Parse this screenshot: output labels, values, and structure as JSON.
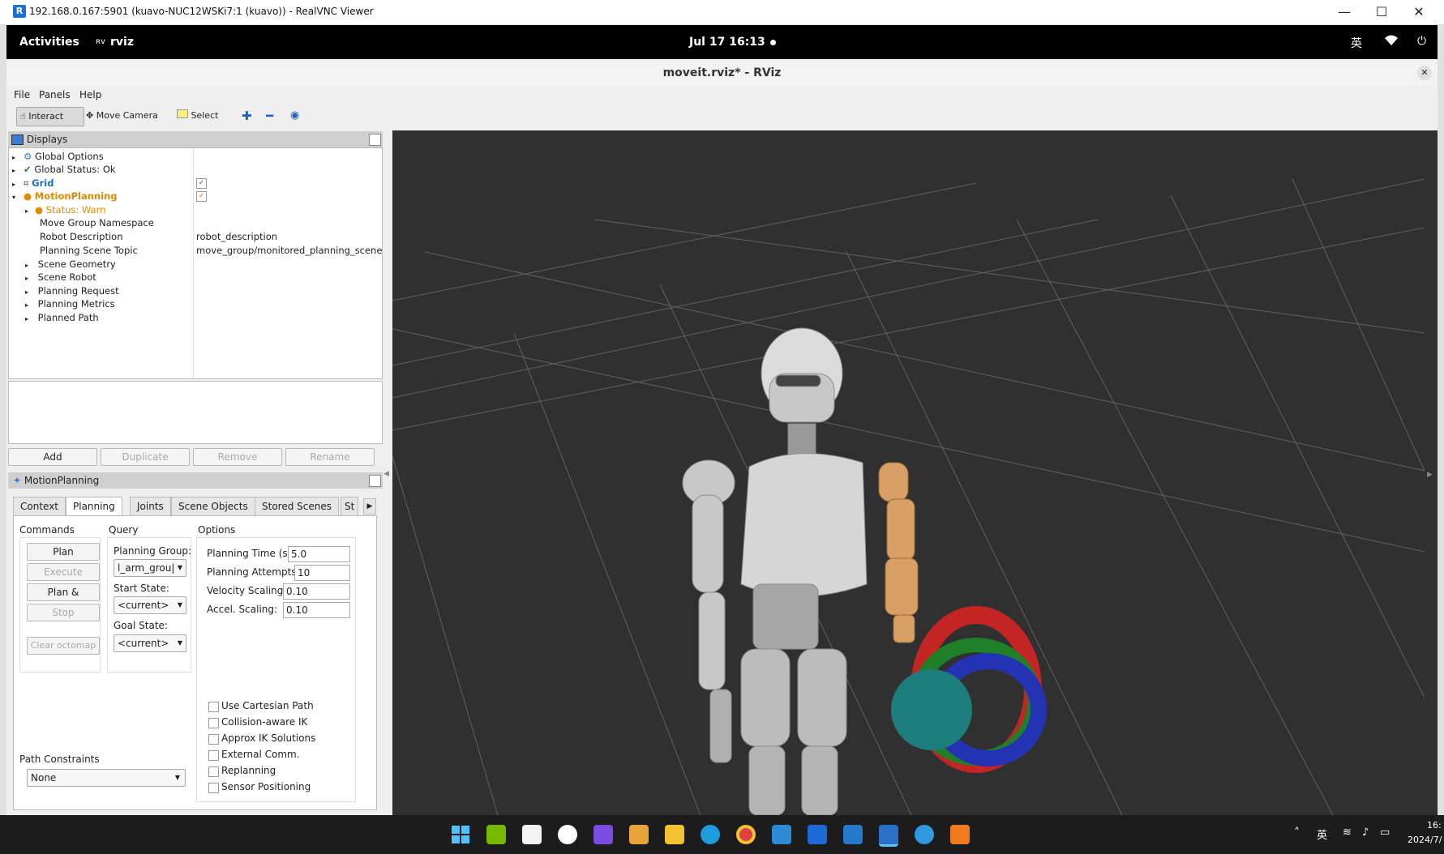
{
  "vnc": {
    "title": "192.168.0.167:5901 (kuavo-NUC12WSKi7:1 (kuavo)) - RealVNC Viewer",
    "icon": "R",
    "min": "—",
    "max": "☐",
    "close": "✕"
  },
  "gnome": {
    "activities": "Activities",
    "app": "rviz",
    "clock": "Jul 17  16:13",
    "ime": "英"
  },
  "rviz": {
    "title": "moveit.rviz* - RViz"
  },
  "menu": {
    "file": "File",
    "panels": "Panels",
    "help": "Help"
  },
  "toolbar": {
    "interact": "Interact",
    "move_camera": "Move Camera",
    "select": "Select"
  },
  "displays": {
    "title": "Displays",
    "items": [
      {
        "label": "Global Options",
        "value": ""
      },
      {
        "label": "Global Status: Ok",
        "value": ""
      },
      {
        "label": "Grid",
        "value": ""
      },
      {
        "label": "MotionPlanning",
        "value": ""
      },
      {
        "label": "Status: Warn",
        "value": ""
      },
      {
        "label": "Move Group Namespace",
        "value": ""
      },
      {
        "label": "Robot Description",
        "value": "robot_description"
      },
      {
        "label": "Planning Scene Topic",
        "value": "move_group/monitored_planning_scene"
      },
      {
        "label": "Scene Geometry",
        "value": ""
      },
      {
        "label": "Scene Robot",
        "value": ""
      },
      {
        "label": "Planning Request",
        "value": ""
      },
      {
        "label": "Planning Metrics",
        "value": ""
      },
      {
        "label": "Planned Path",
        "value": ""
      }
    ],
    "buttons": {
      "add": "Add",
      "duplicate": "Duplicate",
      "remove": "Remove",
      "rename": "Rename"
    }
  },
  "motion": {
    "title": "MotionPlanning",
    "tabs": [
      "Context",
      "Planning",
      "Joints",
      "Scene Objects",
      "Stored Scenes",
      "St"
    ],
    "commands": {
      "heading": "Commands",
      "plan": "Plan",
      "execute": "Execute",
      "plan_execute": "Plan & Execute",
      "stop": "Stop",
      "clear": "Clear octomap"
    },
    "query": {
      "heading": "Query",
      "group_label": "Planning Group:",
      "group": "l_arm_grou|",
      "start_label": "Start State:",
      "start": "<current>",
      "goal_label": "Goal State:",
      "goal": "<current>"
    },
    "options": {
      "heading": "Options",
      "time_label": "Planning Time (s):",
      "time": "5.0",
      "attempts_label": "Planning Attempts:",
      "attempts": "10",
      "vel_label": "Velocity Scaling:",
      "vel": "0.10",
      "acc_label": "Accel. Scaling:",
      "acc": "0.10",
      "checks": [
        "Use Cartesian Path",
        "Collision-aware IK",
        "Approx IK Solutions",
        "External Comm.",
        "Replanning",
        "Sensor Positioning"
      ]
    },
    "path": {
      "label": "Path Constraints",
      "value": "None"
    }
  },
  "taskbar": {
    "ime": "英",
    "time": "16:",
    "date": "2024/7/"
  },
  "colors": {
    "view_bg": "#303030",
    "warn": "#e08a00",
    "grid_blue": "#1a6fc0"
  }
}
